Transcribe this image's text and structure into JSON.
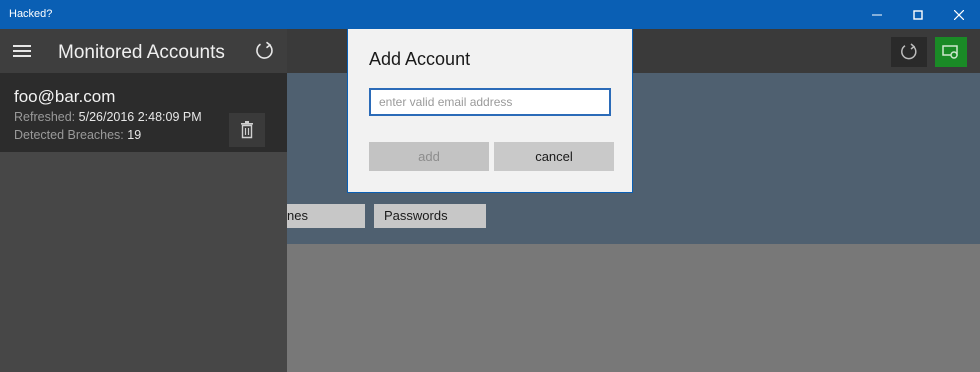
{
  "window": {
    "title": "Hacked?",
    "controls": [
      "minimize-icon",
      "maximize-icon",
      "close-icon"
    ]
  },
  "sidebar": {
    "title": "Monitored Accounts",
    "icons": [
      "hamburger-menu-icon",
      "refresh-icon"
    ],
    "accounts": [
      {
        "email": "foo@bar.com",
        "refreshed_label": "Refreshed:",
        "refreshed_value": "5/26/2016 2:48:09 PM",
        "breaches_label": "Detected Breaches:",
        "breaches_value": "19",
        "action_icon": "trash-icon"
      }
    ]
  },
  "main": {
    "toolbar_icons": [
      "refresh-icon",
      "add-account-icon"
    ],
    "accent_color": "#1a8a26",
    "pivot_tabs": [
      "nes",
      "Passwords"
    ]
  },
  "dialog": {
    "title": "Add Account",
    "email_placeholder": "enter valid email address",
    "email_value": "",
    "add_label": "add",
    "cancel_label": "cancel"
  }
}
